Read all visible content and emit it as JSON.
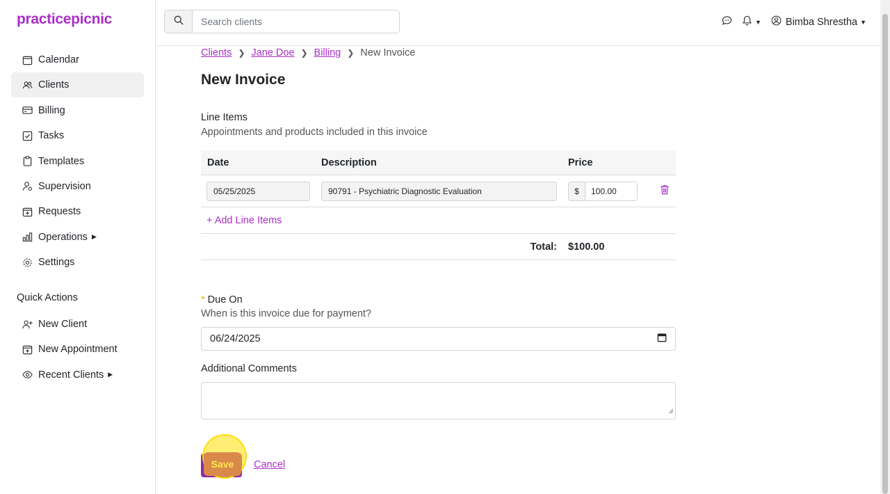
{
  "app": {
    "logo": "practicepicnic",
    "brand_color": "#a92fc6"
  },
  "sidebar": {
    "items": [
      {
        "label": "Calendar",
        "icon": "calendar-icon"
      },
      {
        "label": "Clients",
        "icon": "users-icon",
        "active": true
      },
      {
        "label": "Billing",
        "icon": "credit-card-icon"
      },
      {
        "label": "Tasks",
        "icon": "checkbox-icon"
      },
      {
        "label": "Templates",
        "icon": "clipboard-icon"
      },
      {
        "label": "Supervision",
        "icon": "supervision-icon"
      },
      {
        "label": "Requests",
        "icon": "calendar-plus-icon"
      },
      {
        "label": "Operations",
        "icon": "bar-chart-icon"
      },
      {
        "label": "Settings",
        "icon": "gear-icon"
      }
    ],
    "quick_actions_title": "Quick Actions",
    "quick_actions": [
      {
        "label": "New Client",
        "icon": "user-plus-icon"
      },
      {
        "label": "New Appointment",
        "icon": "calendar-plus-icon"
      },
      {
        "label": "Recent Clients",
        "icon": "eye-icon"
      }
    ]
  },
  "topbar": {
    "search_placeholder": "Search clients",
    "user_name": "Bimba Shrestha"
  },
  "breadcrumb": {
    "items": [
      "Clients",
      "Jane Doe",
      "Billing"
    ],
    "current": "New Invoice"
  },
  "page": {
    "title": "New Invoice",
    "line_items_label": "Line Items",
    "line_items_help": "Appointments and products included in this invoice",
    "columns": {
      "date": "Date",
      "description": "Description",
      "price": "Price"
    },
    "rows": [
      {
        "date": "05/25/2025",
        "description": "90791 - Psychiatric Diagnostic Evaluation",
        "currency": "$",
        "price": "100.00"
      }
    ],
    "add_line_items": "+ Add Line Items",
    "total_label": "Total:",
    "total_value": "$100.00",
    "due_on_required": "*",
    "due_on_label": "Due On",
    "due_on_help": "When is this invoice due for payment?",
    "due_on_value": "06/24/2025",
    "comments_label": "Additional Comments",
    "save_label": "Save",
    "cancel_label": "Cancel"
  }
}
